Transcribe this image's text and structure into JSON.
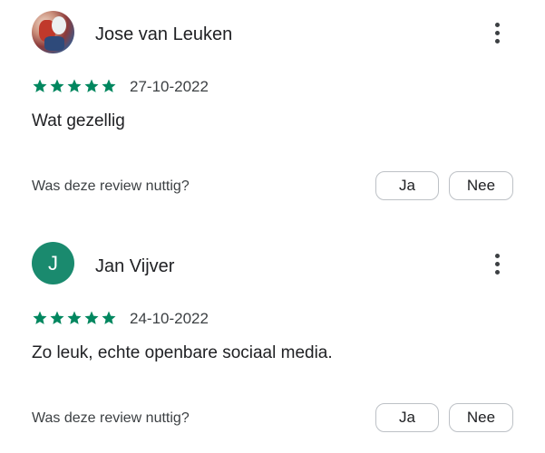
{
  "reviews": [
    {
      "author": "Jose van Leuken",
      "avatar": {
        "type": "photo",
        "icon": "user-photo-avatar"
      },
      "rating": 5,
      "rating_max": 5,
      "date": "27-10-2022",
      "text": "Wat gezellig",
      "helpful_question": "Was deze review nuttig?",
      "yes_label": "Ja",
      "no_label": "Nee"
    },
    {
      "author": "Jan Vijver",
      "avatar": {
        "type": "letter",
        "letter": "J",
        "color": "#1a8a6e"
      },
      "rating": 5,
      "rating_max": 5,
      "date": "24-10-2022",
      "text": "Zo leuk, echte openbare sociaal media.",
      "helpful_question": "Was deze review nuttig?",
      "yes_label": "Ja",
      "no_label": "Nee"
    }
  ],
  "colors": {
    "star": "#01875f",
    "text": "#202124",
    "secondary_text": "#3c4043",
    "button_border": "#bdc1c6"
  },
  "icons": {
    "menu": "more-vert-icon",
    "star": "star-filled-icon"
  }
}
